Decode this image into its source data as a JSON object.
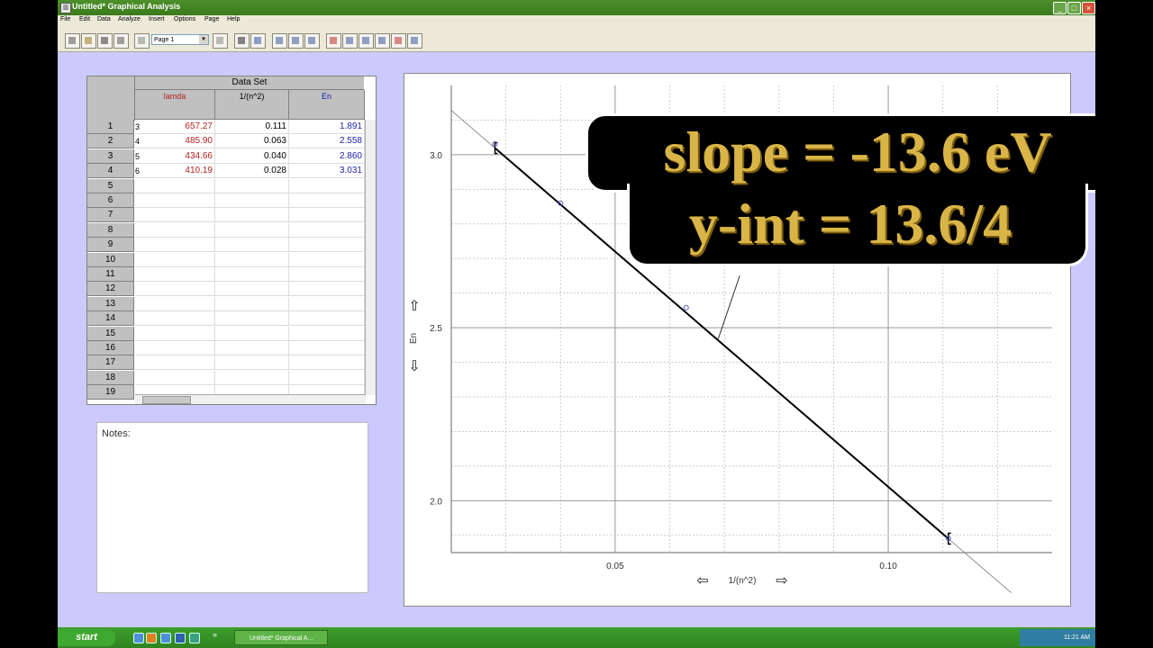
{
  "window": {
    "title": "Untitled* Graphical Analysis",
    "min": "_",
    "max": "□",
    "close": "×"
  },
  "menu": [
    "File",
    "Edit",
    "Data",
    "Analyze",
    "Insert",
    "Options",
    "Page",
    "Help"
  ],
  "toolbar": {
    "page_select": "Page 1"
  },
  "datatable": {
    "title": "Data Set",
    "columns": [
      "lamda",
      "1/(n^2)",
      "En"
    ],
    "rows": [
      {
        "num": "1",
        "n": "3",
        "lamda": "657.27",
        "inv": "0.111",
        "en": "1.891"
      },
      {
        "num": "2",
        "n": "4",
        "lamda": "485.90",
        "inv": "0.063",
        "en": "2.558"
      },
      {
        "num": "3",
        "n": "5",
        "lamda": "434.66",
        "inv": "0.040",
        "en": "2.860"
      },
      {
        "num": "4",
        "n": "6",
        "lamda": "410.19",
        "inv": "0.028",
        "en": "3.031"
      }
    ],
    "empty_rows": [
      "5",
      "6",
      "7",
      "8",
      "9",
      "10",
      "11",
      "12",
      "13",
      "14",
      "15",
      "16",
      "17",
      "18",
      "19"
    ],
    "lamda_color": "#b22222",
    "en_color": "#2222aa"
  },
  "notes": {
    "label": "Notes:"
  },
  "graph": {
    "ylabel": "En",
    "xlabel": "1/(n^2)",
    "up_arrow": "⇧",
    "down_arrow": "⇩",
    "left_arrow": "⇦",
    "right_arrow": "⇨"
  },
  "chart_data": {
    "type": "scatter",
    "x": [
      0.111,
      0.063,
      0.04,
      0.028
    ],
    "y": [
      1.891,
      2.558,
      2.86,
      3.031
    ],
    "xlabel": "1/(n^2)",
    "ylabel": "En",
    "xlim": [
      0.02,
      0.13
    ],
    "ylim": [
      1.85,
      3.2
    ],
    "xticks": [
      "0.05",
      "0.10"
    ],
    "yticks": [
      "2.0",
      "2.5",
      "3.0"
    ],
    "fit": {
      "slope": -13.6,
      "intercept": 3.4
    },
    "grid": true,
    "point_color": "#5555cc"
  },
  "overlay": {
    "line1": "slope = -13.6 eV",
    "line2": "y-int = 13.6/4"
  },
  "taskbar": {
    "start": "start",
    "task": "Untitled* Graphical A...",
    "clock": "11:21 AM",
    "chevron": "»"
  }
}
